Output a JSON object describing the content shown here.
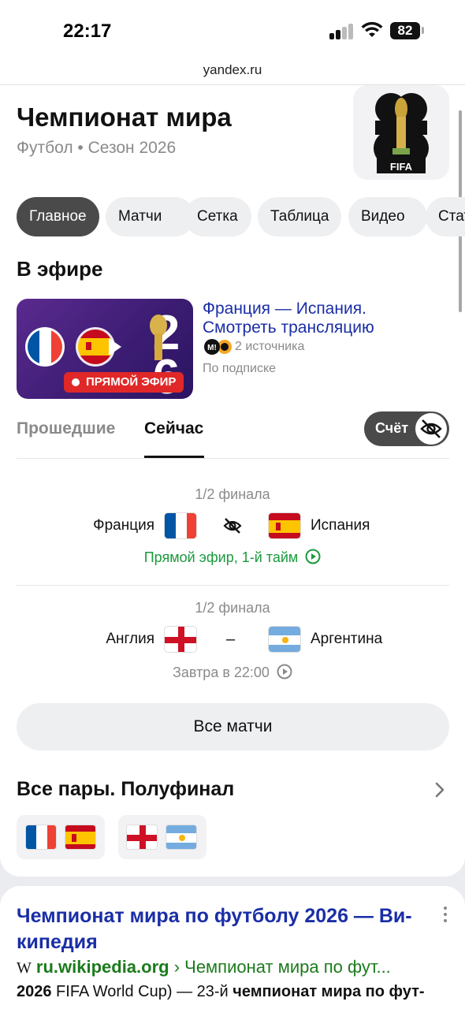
{
  "status_bar": {
    "time": "22:17",
    "battery": "82"
  },
  "url_bar": {
    "domain": "yandex.ru"
  },
  "header": {
    "title": "Чемпионат мира",
    "subtitle": "Футбол • Сезон 2026",
    "logo_text": "FIFA"
  },
  "tabs": [
    {
      "label": "Главное"
    },
    {
      "label": "Матчи"
    },
    {
      "label": "Сетка"
    },
    {
      "label": "Таблица"
    },
    {
      "label": "Видео"
    },
    {
      "label": "Статистика"
    }
  ],
  "live_section": {
    "heading": "В эфире",
    "badge": "ПРЯМОЙ ЭФИР",
    "title_line1": "Франция — Испания.",
    "title_line2": "Смотреть трансляцию",
    "source_icon_text": "M!",
    "sources": "2 источника",
    "subscription": "По подписке"
  },
  "match_tabs": {
    "past": "Прошедшие",
    "now": "Сейчас",
    "score_toggle": "Счёт"
  },
  "matches": [
    {
      "stage": "1/2 финала",
      "home": "Франция",
      "away": "Испания",
      "status": "Прямой эфир, 1-й тайм",
      "status_color": "#1a9a3c"
    },
    {
      "stage": "1/2 финала",
      "home": "Англия",
      "away": "Аргентина",
      "separator": "–",
      "status": "Завтра в 22:00",
      "status_color": "#8a8a8a"
    }
  ],
  "all_matches_button": "Все матчи",
  "pairs": {
    "heading": "Все пары. Полуфинал"
  },
  "search_result": {
    "title": "Чемпионат мира по футболу 2026 — Ви-кипедия",
    "favicon": "W",
    "domain": "ru.wikipedia.org",
    "breadcrumb": "› Чемпионат мира по фут...",
    "snippet_bold1": "2026",
    "snippet_mid": " FIFA World Cup) — 23-й ",
    "snippet_bold2": "чемпионат мира по фут-"
  }
}
